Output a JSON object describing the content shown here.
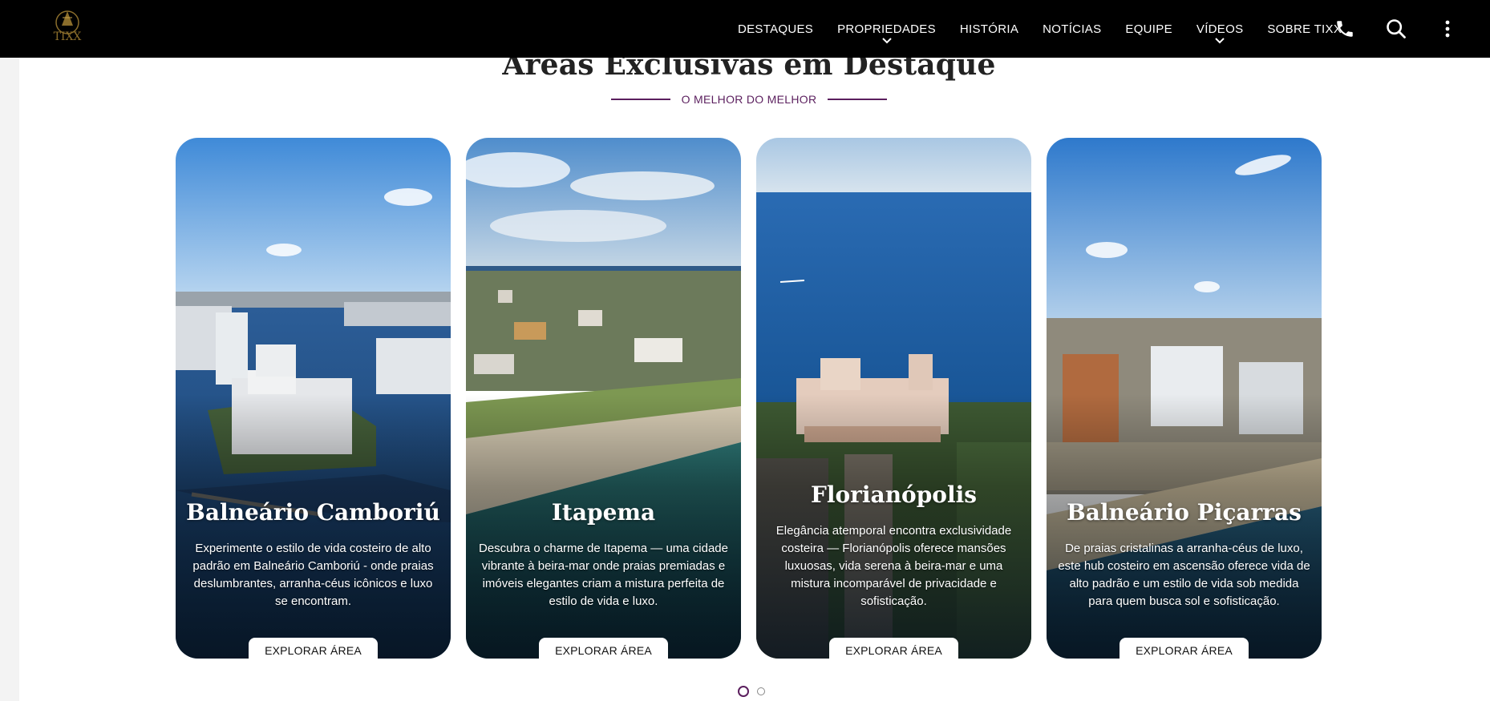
{
  "nav": {
    "logo_text": "TIXX",
    "items": [
      {
        "label": "DESTAQUES"
      },
      {
        "label": "PROPRIEDADES"
      },
      {
        "label": "HISTÓRIA"
      },
      {
        "label": "NOTÍCIAS"
      },
      {
        "label": "EQUIPE"
      },
      {
        "label": "VÍDEOS"
      },
      {
        "label": "SOBRE TIXX"
      }
    ],
    "icons": [
      "phone-icon",
      "search-icon",
      "more-vertical-icon"
    ]
  },
  "section": {
    "title": "Áreas Exclusivas em Destaque",
    "subtitle": "O MELHOR DO MELHOR"
  },
  "cards": [
    {
      "title": "Balneário Camboriú",
      "description": "Experimente o estilo de vida costeiro de alto padrão em Balneário Camboriú - onde praias deslumbrantes, arranha-céus icônicos e luxo se encontram.",
      "button": "EXPLORAR ÁREA"
    },
    {
      "title": "Itapema",
      "description": "Descubra o charme de Itapema — uma cidade vibrante à beira-mar onde praias premiadas e imóveis elegantes criam a mistura perfeita de estilo de vida e luxo.",
      "button": "EXPLORAR ÁREA"
    },
    {
      "title": "Florianópolis",
      "description": "Elegância atemporal encontra exclusividade costeira — Florianópolis oferece mansões luxuosas, vida serena à beira-mar e uma mistura incomparável de privacidade e sofisticação.",
      "button": "EXPLORAR ÁREA"
    },
    {
      "title": "Balneário Piçarras",
      "description": "De praias cristalinas a arranha-céus de luxo, este hub costeiro em ascensão oferece vida de alto padrão e um estilo de vida sob medida para quem busca sol e sofisticação.",
      "button": "EXPLORAR ÁREA"
    }
  ],
  "pagination": {
    "pages": 2,
    "current": 1
  },
  "colors": {
    "accent": "#5b1f5e",
    "nav_bg": "#000000"
  }
}
